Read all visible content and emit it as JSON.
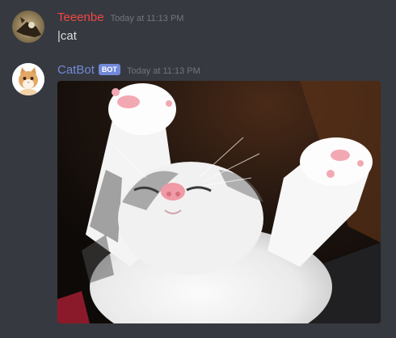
{
  "colors": {
    "background": "#36393f",
    "user1_name": "#f04747",
    "bot_name": "#7289da",
    "bot_tag_bg": "#7289da",
    "timestamp": "#72767d",
    "text": "#dcddde"
  },
  "messages": [
    {
      "author": "Teeenbe",
      "timestamp": "Today at 11:13 PM",
      "content": "|cat",
      "avatar_icon": "user-avatar"
    },
    {
      "author": "CatBot",
      "bot_tag": "BOT",
      "timestamp": "Today at 11:13 PM",
      "attachment_icon": "kitten-photo",
      "avatar_icon": "kitten-avatar"
    }
  ]
}
